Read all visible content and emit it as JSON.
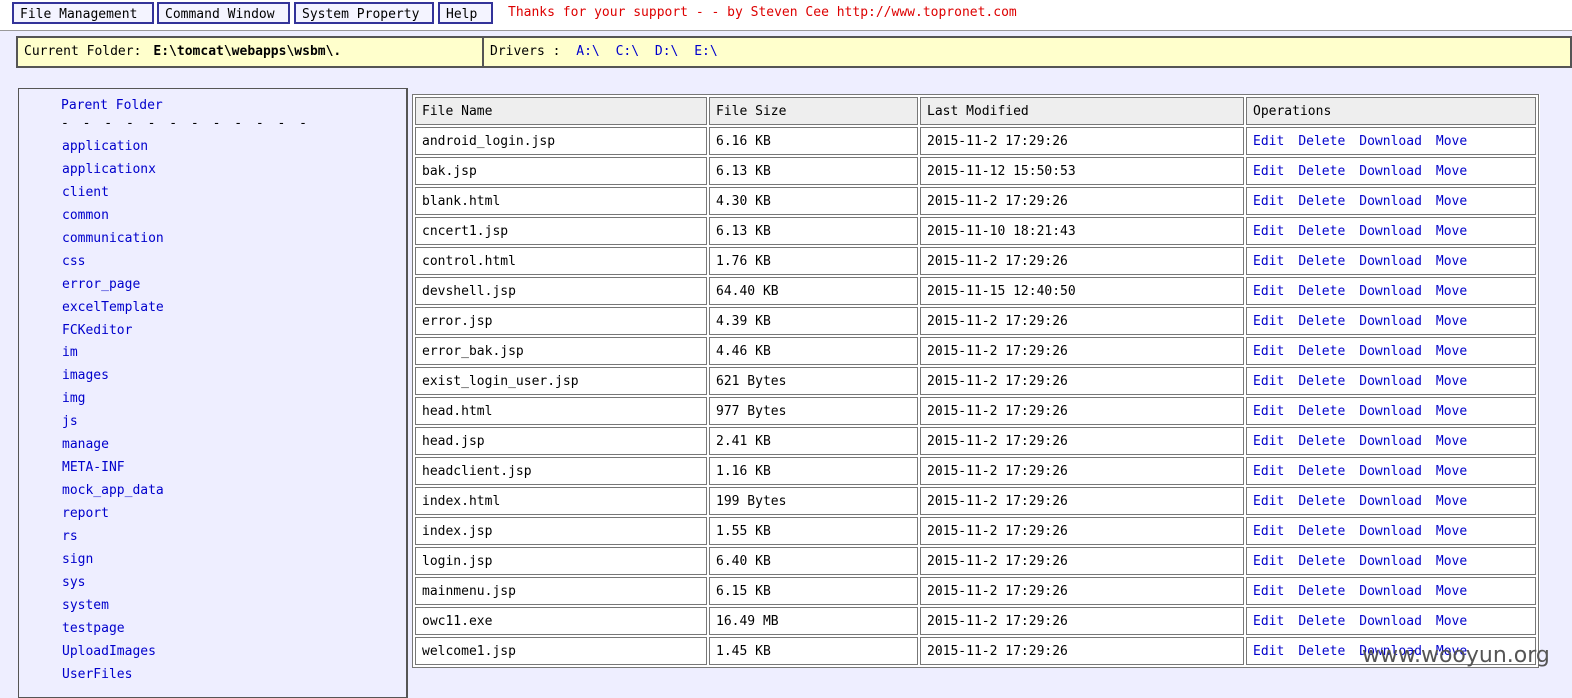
{
  "menu": {
    "file_management": "File Management",
    "command_window": "Command Window",
    "system_property": "System Property",
    "help": "Help"
  },
  "thanks": "Thanks for your support - - by Steven Cee http://www.topronet.com",
  "folder_bar": {
    "current_label": "Current Folder:",
    "current_path": "E:\\tomcat\\webapps\\wsbm\\.",
    "drivers_label": "Drivers :",
    "drives": [
      "A:\\",
      "C:\\",
      "D:\\",
      "E:\\"
    ]
  },
  "sidebar": {
    "parent_folder": "Parent Folder",
    "separator": "- - - - - - - - - - - -",
    "folders": [
      "application",
      "applicationx",
      "client",
      "common",
      "communication",
      "css",
      "error_page",
      "excelTemplate",
      "FCKeditor",
      "im",
      "images",
      "img",
      "js",
      "manage",
      "META-INF",
      "mock_app_data",
      "report",
      "rs",
      "sign",
      "sys",
      "system",
      "testpage",
      "UploadImages",
      "UserFiles"
    ]
  },
  "table": {
    "headers": [
      "File Name",
      "File Size",
      "Last Modified",
      "Operations"
    ],
    "ops": [
      "Edit",
      "Delete",
      "Download",
      "Move"
    ],
    "rows": [
      [
        "android_login.jsp",
        "6.16 KB",
        "2015-11-2 17:29:26"
      ],
      [
        "bak.jsp",
        "6.13 KB",
        "2015-11-12 15:50:53"
      ],
      [
        "blank.html",
        "4.30 KB",
        "2015-11-2 17:29:26"
      ],
      [
        "cncert1.jsp",
        "6.13 KB",
        "2015-11-10 18:21:43"
      ],
      [
        "control.html",
        "1.76 KB",
        "2015-11-2 17:29:26"
      ],
      [
        "devshell.jsp",
        "64.40 KB",
        "2015-11-15 12:40:50"
      ],
      [
        "error.jsp",
        "4.39 KB",
        "2015-11-2 17:29:26"
      ],
      [
        "error_bak.jsp",
        "4.46 KB",
        "2015-11-2 17:29:26"
      ],
      [
        "exist_login_user.jsp",
        "621 Bytes",
        "2015-11-2 17:29:26"
      ],
      [
        "head.html",
        "977 Bytes",
        "2015-11-2 17:29:26"
      ],
      [
        "head.jsp",
        "2.41 KB",
        "2015-11-2 17:29:26"
      ],
      [
        "headclient.jsp",
        "1.16 KB",
        "2015-11-2 17:29:26"
      ],
      [
        "index.html",
        "199 Bytes",
        "2015-11-2 17:29:26"
      ],
      [
        "index.jsp",
        "1.55 KB",
        "2015-11-2 17:29:26"
      ],
      [
        "login.jsp",
        "6.40 KB",
        "2015-11-2 17:29:26"
      ],
      [
        "mainmenu.jsp",
        "6.15 KB",
        "2015-11-2 17:29:26"
      ],
      [
        "owc11.exe",
        "16.49 MB",
        "2015-11-2 17:29:26"
      ],
      [
        "welcome1.jsp",
        "1.45 KB",
        "2015-11-2 17:29:26"
      ]
    ]
  },
  "watermark": "www.wooyun.org"
}
